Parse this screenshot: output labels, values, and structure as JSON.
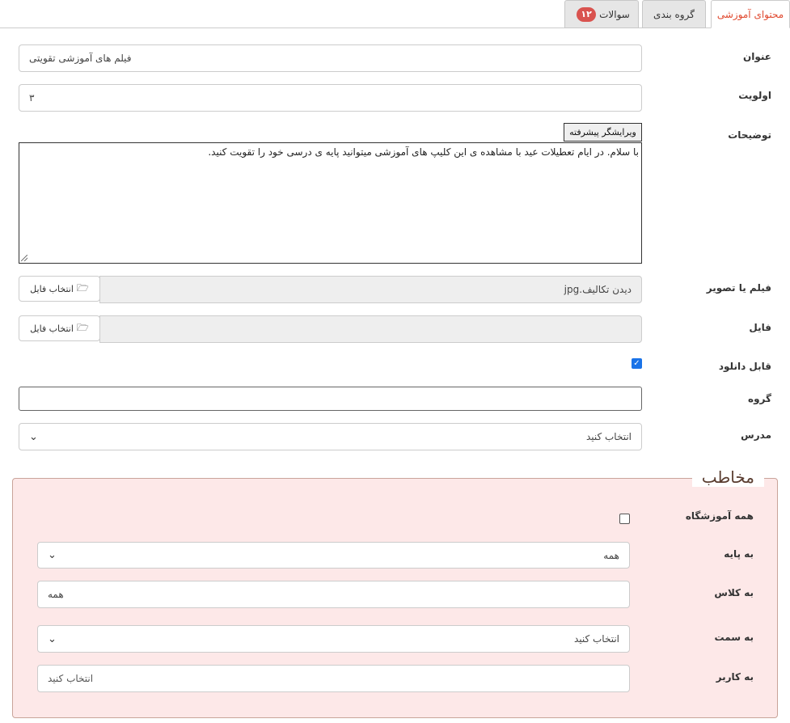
{
  "tabs": [
    {
      "label": "محتوای آموزشی"
    },
    {
      "label": "گروه بندی"
    },
    {
      "label": "سوالات",
      "badge": "۱۲"
    }
  ],
  "form": {
    "title": {
      "label": "عنوان",
      "value": "فیلم های آموزشی تقویتی"
    },
    "priority": {
      "label": "اولویت",
      "value": "۳"
    },
    "description": {
      "label": "توضیحات",
      "editor_button": "ویرایشگر پیشرفته",
      "value": "با سلام. در ایام تعطیلات عید با مشاهده ی این کلیپ های آموزشی میتوانید پایه ی درسی خود را تقویت کنید."
    },
    "media": {
      "label": "فیلم یا تصویر",
      "value": "دیدن تکالیف.jpg",
      "button": "انتخاب فایل"
    },
    "file": {
      "label": "فایل",
      "value": "",
      "button": "انتخاب فایل"
    },
    "downloadable": {
      "label": "قابل دانلود",
      "checked": true
    },
    "group": {
      "label": "گروه",
      "value": ""
    },
    "teacher": {
      "label": "مدرس",
      "value": "انتخاب کنید"
    }
  },
  "audience": {
    "legend": "مخاطب",
    "whole_school": {
      "label": "همه آموزشگاه",
      "checked": false
    },
    "grade": {
      "label": "به پایه",
      "value": "همه"
    },
    "class": {
      "label": "به کلاس",
      "value": "همه"
    },
    "position": {
      "label": "به سمت",
      "value": "انتخاب کنید"
    },
    "user": {
      "label": "به کاربر",
      "value": "انتخاب کنید"
    }
  },
  "icons": {
    "folder": "folder-open-icon",
    "chevron": "chevron-down-icon",
    "check": "check-icon"
  }
}
